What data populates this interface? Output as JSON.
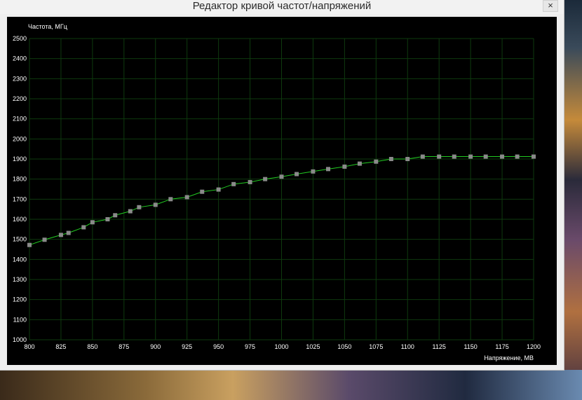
{
  "window": {
    "title": "Редактор кривой частот/напряжений",
    "close_label": "×"
  },
  "colors": {
    "plot_background": "#000000",
    "grid": "#0e3a0e",
    "line": "#22cc22",
    "marker": "#8a8a8a",
    "text": "#ffffff"
  },
  "chart_data": {
    "type": "line",
    "title": "",
    "ylabel": "Частота, МГц",
    "xlabel": "Напряжение, МВ",
    "xlim": [
      800,
      1200
    ],
    "ylim": [
      1000,
      2500
    ],
    "x_ticks": [
      800,
      825,
      850,
      875,
      900,
      925,
      950,
      975,
      1000,
      1025,
      1050,
      1075,
      1100,
      1125,
      1150,
      1175,
      1200
    ],
    "y_ticks": [
      1000,
      1100,
      1200,
      1300,
      1400,
      1500,
      1600,
      1700,
      1800,
      1900,
      2000,
      2100,
      2200,
      2300,
      2400,
      2500
    ],
    "grid": true,
    "series": [
      {
        "x": [
          800,
          812,
          825,
          831,
          843,
          850,
          862,
          868,
          880,
          887,
          900,
          912,
          925,
          937,
          950,
          962,
          975,
          987,
          1000,
          1012,
          1025,
          1037,
          1050,
          1062,
          1075,
          1087,
          1100,
          1112,
          1125,
          1137,
          1150,
          1162,
          1175,
          1187,
          1200
        ],
        "y": [
          1472,
          1498,
          1522,
          1532,
          1560,
          1585,
          1600,
          1620,
          1640,
          1660,
          1672,
          1700,
          1710,
          1737,
          1748,
          1775,
          1785,
          1800,
          1812,
          1825,
          1838,
          1850,
          1862,
          1877,
          1887,
          1900,
          1900,
          1912,
          1912,
          1912,
          1912,
          1912,
          1912,
          1912,
          1912
        ]
      }
    ]
  }
}
